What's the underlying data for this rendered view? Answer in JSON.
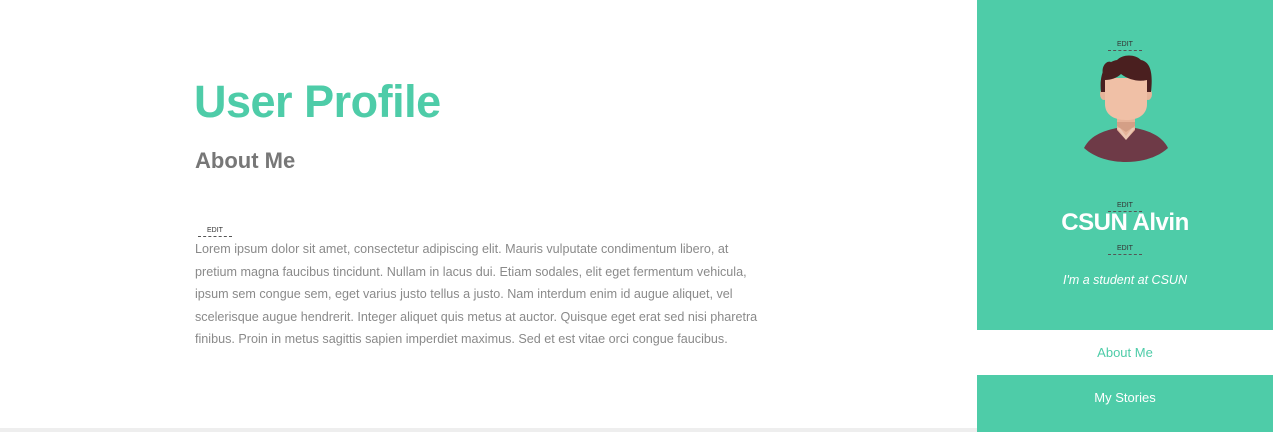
{
  "main": {
    "title": "User Profile",
    "section_heading": "About Me",
    "edit_label": "EDIT",
    "about_text": "Lorem ipsum dolor sit amet, consectetur adipiscing elit. Mauris vulputate condimentum libero, at pretium magna faucibus tincidunt. Nullam in lacus dui. Etiam sodales, elit eget fermentum vehicula, ipsum sem congue sem, eget varius justo tellus a justo. Nam interdum enim id augue aliquet, vel scelerisque augue hendrerit. Integer aliquet quis metus at auctor. Quisque eget erat sed nisi pharetra finibus. Proin in metus sagittis sapien imperdiet maximus. Sed et est vitae orci congue faucibus."
  },
  "sidebar": {
    "avatar_icon": "male-avatar-icon",
    "edit_label": "EDIT",
    "name": "CSUN Alvin",
    "bio": "I'm a student at CSUN",
    "nav": [
      {
        "label": "About Me",
        "active": true
      },
      {
        "label": "My Stories",
        "active": false
      }
    ]
  },
  "colors": {
    "accent": "#4ecca8",
    "heading_gray": "#777777",
    "body_text": "#8a8a8a",
    "background": "#ffffff"
  }
}
